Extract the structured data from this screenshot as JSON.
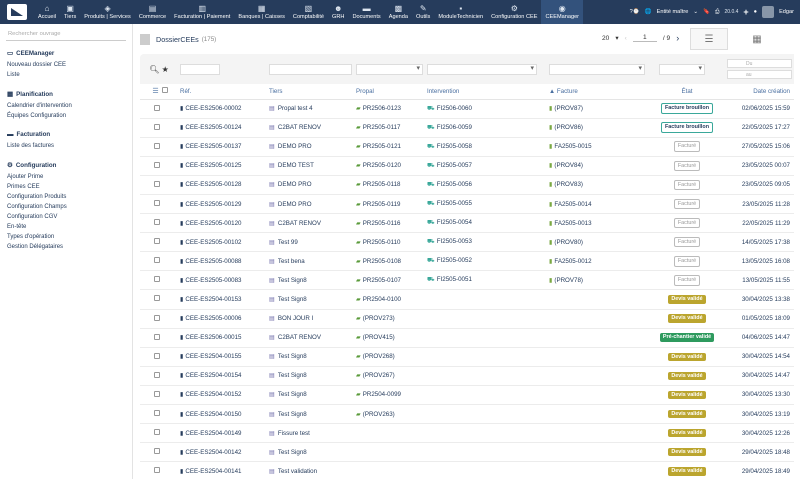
{
  "topbar": {
    "menu": [
      {
        "label": "Accueil",
        "icon": "home-icon"
      },
      {
        "label": "Tiers",
        "icon": "building-icon"
      },
      {
        "label": "Produits | Services",
        "icon": "cube-icon"
      },
      {
        "label": "Commerce",
        "icon": "briefcase-icon"
      },
      {
        "label": "Facturation | Paiement",
        "icon": "money-icon"
      },
      {
        "label": "Banques | Caisses",
        "icon": "bank-icon"
      },
      {
        "label": "Comptabilité",
        "icon": "calculator-icon"
      },
      {
        "label": "GRH",
        "icon": "users-icon"
      },
      {
        "label": "Documents",
        "icon": "folder-icon"
      },
      {
        "label": "Agenda",
        "icon": "calendar-icon"
      },
      {
        "label": "Outils",
        "icon": "wrench-icon"
      },
      {
        "label": "ModuleTechnicien",
        "icon": "module-icon"
      },
      {
        "label": "Configuration CEE",
        "icon": "cog-icon"
      },
      {
        "label": "CEEManager",
        "icon": "cee-icon"
      }
    ],
    "entity": "Entité maître",
    "version": "20.0.4",
    "user": "Edgar"
  },
  "sidebar": {
    "search_placeholder": "Rechercher ouvrage",
    "sections": [
      {
        "title": "CEEManager",
        "links": [
          "Nouveau dossier CEE",
          "Liste"
        ]
      },
      {
        "title": "Planification",
        "links": [
          "Calendrier d'intervention",
          "Équipes Configuration"
        ]
      },
      {
        "title": "Facturation",
        "links": [
          "Liste des factures"
        ]
      },
      {
        "title": "Configuration",
        "links": [
          "Ajouter Prime",
          "Primes CEE",
          "Configuration Produits",
          "Configuration Champs",
          "Configuration CGV",
          "En-tête",
          "Types d'opération",
          "Gestion Délégataires"
        ]
      }
    ]
  },
  "main": {
    "title": "DossierCEEs",
    "count": "(175)",
    "per_page": "20",
    "page": "1",
    "total_pages": "/ 9",
    "date_from": "Du",
    "date_to": "au",
    "columns": {
      "ref": "Réf.",
      "tiers": "Tiers",
      "propal": "Propal",
      "intervention": "Intervention",
      "facture": "Facture",
      "etat": "État",
      "date": "Date création"
    },
    "rows": [
      {
        "ref": "CEE-ES2506-00002",
        "tiers": "Propal test 4",
        "propal": "PR2506-0123",
        "intervention": "FI2506-0060",
        "facture": "(PROV87)",
        "etat": "Facture brouillon",
        "etat_type": "brouillon",
        "date": "02/06/2025 15:59"
      },
      {
        "ref": "CEE-ES2505-00124",
        "tiers": "C2BAT RENOV",
        "propal": "PR2505-0117",
        "intervention": "FI2506-0059",
        "facture": "(PROV86)",
        "etat": "Facture brouillon",
        "etat_type": "brouillon",
        "date": "22/05/2025 17:27"
      },
      {
        "ref": "CEE-ES2505-00137",
        "tiers": "DEMO PRO",
        "propal": "PR2505-0121",
        "intervention": "FI2505-0058",
        "facture": "FA2505-0015",
        "etat": "Facturé",
        "etat_type": "facture",
        "date": "27/05/2025 15:06"
      },
      {
        "ref": "CEE-ES2505-00125",
        "tiers": "DEMO TEST",
        "propal": "PR2505-0120",
        "intervention": "FI2505-0057",
        "facture": "(PROV84)",
        "etat": "Facturé",
        "etat_type": "facture",
        "date": "23/05/2025 00:07"
      },
      {
        "ref": "CEE-ES2505-00128",
        "tiers": "DEMO PRO",
        "propal": "PR2505-0118",
        "intervention": "FI2505-0056",
        "facture": "(PROV83)",
        "etat": "Facturé",
        "etat_type": "facture",
        "date": "23/05/2025 09:05"
      },
      {
        "ref": "CEE-ES2505-00129",
        "tiers": "DEMO PRO",
        "propal": "PR2505-0119",
        "intervention": "FI2505-0055",
        "facture": "FA2505-0014",
        "etat": "Facturé",
        "etat_type": "facture",
        "date": "23/05/2025 11:28"
      },
      {
        "ref": "CEE-ES2505-00120",
        "tiers": "C2BAT RENOV",
        "propal": "PR2505-0116",
        "intervention": "FI2505-0054",
        "facture": "FA2505-0013",
        "etat": "Facturé",
        "etat_type": "facture",
        "date": "22/05/2025 11:29"
      },
      {
        "ref": "CEE-ES2505-00102",
        "tiers": "Test 99",
        "propal": "PR2505-0110",
        "intervention": "FI2505-0053",
        "facture": "(PROV80)",
        "etat": "Facturé",
        "etat_type": "facture",
        "date": "14/05/2025 17:38"
      },
      {
        "ref": "CEE-ES2505-00088",
        "tiers": "Test bena",
        "propal": "PR2505-0108",
        "intervention": "FI2505-0052",
        "facture": "FA2505-0012",
        "etat": "Facturé",
        "etat_type": "facture",
        "date": "13/05/2025 16:08"
      },
      {
        "ref": "CEE-ES2505-00083",
        "tiers": "Test Sign8",
        "propal": "PR2505-0107",
        "intervention": "FI2505-0051",
        "facture": "(PROV78)",
        "etat": "Facturé",
        "etat_type": "facture",
        "date": "13/05/2025 11:55"
      },
      {
        "ref": "CEE-ES2504-00153",
        "tiers": "Test Sign8",
        "propal": "PR2504-0100",
        "intervention": "",
        "facture": "",
        "etat": "Devis validé",
        "etat_type": "valide",
        "date": "30/04/2025 13:38"
      },
      {
        "ref": "CEE-ES2505-00006",
        "tiers": "BON JOUR I",
        "propal": "(PROV273)",
        "intervention": "",
        "facture": "",
        "etat": "Devis validé",
        "etat_type": "valide",
        "date": "01/05/2025 18:09"
      },
      {
        "ref": "CEE-ES2506-00015",
        "tiers": "C2BAT RENOV",
        "propal": "(PROV415)",
        "intervention": "",
        "facture": "",
        "etat": "Pré-chantier validé",
        "etat_type": "chantier",
        "date": "04/06/2025 14:47"
      },
      {
        "ref": "CEE-ES2504-00155",
        "tiers": "Test Sign8",
        "propal": "(PROV268)",
        "intervention": "",
        "facture": "",
        "etat": "Devis validé",
        "etat_type": "valide",
        "date": "30/04/2025 14:54"
      },
      {
        "ref": "CEE-ES2504-00154",
        "tiers": "Test Sign8",
        "propal": "(PROV267)",
        "intervention": "",
        "facture": "",
        "etat": "Devis validé",
        "etat_type": "valide",
        "date": "30/04/2025 14:47"
      },
      {
        "ref": "CEE-ES2504-00152",
        "tiers": "Test Sign8",
        "propal": "PR2504-0099",
        "intervention": "",
        "facture": "",
        "etat": "Devis validé",
        "etat_type": "valide",
        "date": "30/04/2025 13:30"
      },
      {
        "ref": "CEE-ES2504-00150",
        "tiers": "Test Sign8",
        "propal": "(PROV263)",
        "intervention": "",
        "facture": "",
        "etat": "Devis validé",
        "etat_type": "valide",
        "date": "30/04/2025 13:19"
      },
      {
        "ref": "CEE-ES2504-00149",
        "tiers": "Fissure test",
        "propal": "",
        "intervention": "",
        "facture": "",
        "etat": "Devis validé",
        "etat_type": "valide",
        "date": "30/04/2025 12:26"
      },
      {
        "ref": "CEE-ES2504-00142",
        "tiers": "Test Sign8",
        "propal": "",
        "intervention": "",
        "facture": "",
        "etat": "Devis validé",
        "etat_type": "valide",
        "date": "29/04/2025 18:48"
      },
      {
        "ref": "CEE-ES2504-00141",
        "tiers": "Test validation",
        "propal": "",
        "intervention": "",
        "facture": "",
        "etat": "Devis validé",
        "etat_type": "valide",
        "date": "29/04/2025 18:49"
      }
    ]
  }
}
